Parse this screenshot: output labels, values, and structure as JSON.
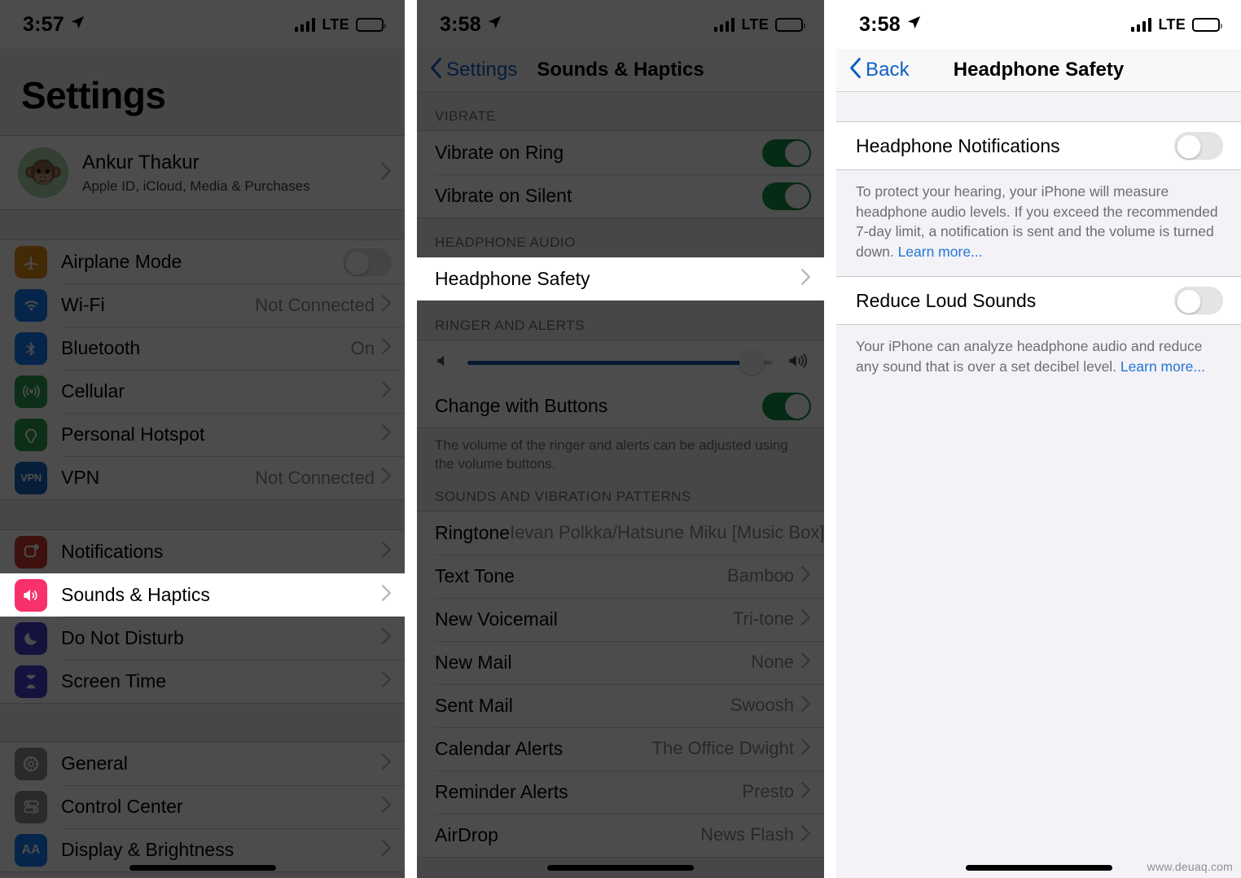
{
  "panels": {
    "settings": {
      "status": {
        "time": "3:57",
        "carrier": "LTE"
      },
      "title": "Settings",
      "profile": {
        "name": "Ankur Thakur",
        "subtitle": "Apple ID, iCloud, Media & Purchases",
        "avatar_icon": "monkey-memoji"
      },
      "groups": [
        {
          "rows": [
            {
              "label": "Airplane Mode",
              "icon": "airplane-icon",
              "icon_color": "#e08c18",
              "type": "toggle",
              "toggle": "off"
            },
            {
              "label": "Wi-Fi",
              "icon": "wifi-icon",
              "icon_color": "#147efb",
              "type": "value",
              "value": "Not Connected"
            },
            {
              "label": "Bluetooth",
              "icon": "bluetooth-icon",
              "icon_color": "#147efb",
              "type": "value",
              "value": "On"
            },
            {
              "label": "Cellular",
              "icon": "cellular-icon",
              "icon_color": "#2e9e4f",
              "type": "chevron",
              "value": ""
            },
            {
              "label": "Personal Hotspot",
              "icon": "hotspot-icon",
              "icon_color": "#2e9e4f",
              "type": "chevron",
              "value": ""
            },
            {
              "label": "VPN",
              "icon": "vpn-icon",
              "icon_color": "#1465c0",
              "type": "value",
              "value": "Not Connected"
            }
          ]
        },
        {
          "rows": [
            {
              "label": "Notifications",
              "icon": "notifications-icon",
              "icon_color": "#cf3a32",
              "type": "chevron",
              "value": ""
            },
            {
              "label": "Sounds & Haptics",
              "icon": "sounds-icon",
              "icon_color": "#f8316a",
              "type": "chevron",
              "value": "",
              "highlighted": true
            },
            {
              "label": "Do Not Disturb",
              "icon": "moon-icon",
              "icon_color": "#483fd0",
              "type": "chevron",
              "value": ""
            },
            {
              "label": "Screen Time",
              "icon": "hourglass-icon",
              "icon_color": "#483fd0",
              "type": "chevron",
              "value": ""
            }
          ]
        },
        {
          "rows": [
            {
              "label": "General",
              "icon": "gear-icon",
              "icon_color": "#8e8e93",
              "type": "chevron",
              "value": ""
            },
            {
              "label": "Control Center",
              "icon": "control-center-icon",
              "icon_color": "#8e8e93",
              "type": "chevron",
              "value": ""
            },
            {
              "label": "Display & Brightness",
              "icon": "display-brightness-icon",
              "icon_color": "#147efb",
              "type": "chevron",
              "value": ""
            }
          ]
        }
      ]
    },
    "sounds": {
      "status": {
        "time": "3:58",
        "carrier": "LTE"
      },
      "nav": {
        "back_label": "Settings",
        "title": "Sounds & Haptics"
      },
      "vibrate": {
        "header": "VIBRATE",
        "rows": [
          {
            "label": "Vibrate on Ring",
            "toggle": "on"
          },
          {
            "label": "Vibrate on Silent",
            "toggle": "on"
          }
        ]
      },
      "headphone_audio": {
        "header": "HEADPHONE AUDIO",
        "rows": [
          {
            "label": "Headphone Safety",
            "highlighted": true
          }
        ]
      },
      "ringer": {
        "header": "RINGER AND ALERTS",
        "slider_value": 93,
        "min_icon": "speaker-low-icon",
        "max_icon": "speaker-high-icon",
        "change_with_buttons": {
          "label": "Change with Buttons",
          "toggle": "on"
        },
        "footer": "The volume of the ringer and alerts can be adjusted using the volume buttons."
      },
      "patterns": {
        "header": "SOUNDS AND VIBRATION PATTERNS",
        "rows": [
          {
            "label": "Ringtone",
            "value": "Ievan Polkka/Hatsune Miku [Music Box]"
          },
          {
            "label": "Text Tone",
            "value": "Bamboo"
          },
          {
            "label": "New Voicemail",
            "value": "Tri-tone"
          },
          {
            "label": "New Mail",
            "value": "None"
          },
          {
            "label": "Sent Mail",
            "value": "Swoosh"
          },
          {
            "label": "Calendar Alerts",
            "value": "The Office Dwight"
          },
          {
            "label": "Reminder Alerts",
            "value": "Presto"
          },
          {
            "label": "AirDrop",
            "value": "News Flash"
          }
        ]
      }
    },
    "headphone_safety": {
      "status": {
        "time": "3:58",
        "carrier": "LTE"
      },
      "nav": {
        "back_label": "Back",
        "title": "Headphone Safety"
      },
      "notifications": {
        "label": "Headphone Notifications",
        "toggle": "off",
        "footer_text": "To protect your hearing, your iPhone will measure headphone audio levels. If you exceed the recommended 7-day limit, a notification is sent and the volume is turned down. ",
        "footer_link": "Learn more..."
      },
      "reduce_loud": {
        "label": "Reduce Loud Sounds",
        "toggle": "off",
        "footer_text": "Your iPhone can analyze headphone audio and reduce any sound that is over a set decibel level. ",
        "footer_link": "Learn more..."
      }
    }
  },
  "watermark": "www.deuaq.com",
  "colors": {
    "accent_blue": "#0b60c4",
    "link_blue": "#2477d6",
    "toggle_on_green": "#169048",
    "slider_blue": "#1456a0",
    "group_bg": "#efeff4"
  }
}
